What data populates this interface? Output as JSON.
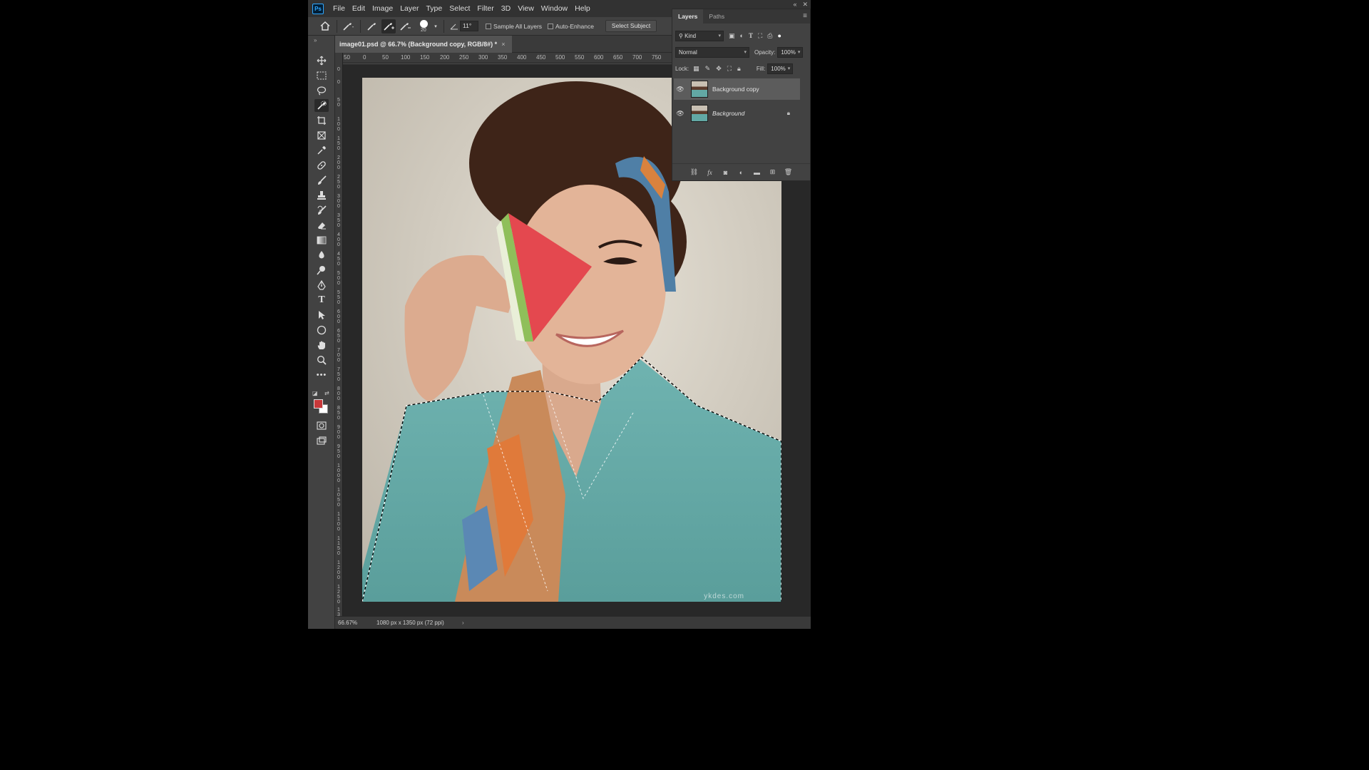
{
  "app": {
    "logo": "Ps"
  },
  "menu": [
    "File",
    "Edit",
    "Image",
    "Layer",
    "Type",
    "Select",
    "Filter",
    "3D",
    "View",
    "Window",
    "Help"
  ],
  "window_controls": {
    "collapse": "«",
    "close": "✕"
  },
  "options": {
    "brush_size": "20",
    "angle": "11°",
    "sample_all_layers": "Sample All Layers",
    "auto_enhance": "Auto-Enhance",
    "select_subject": "Select Subject"
  },
  "document": {
    "tab_title": "image01.psd @ 66.7% (Background copy, RGB/8#) *",
    "close": "×"
  },
  "ruler": {
    "h_ticks": [
      "50",
      "0",
      "50",
      "100",
      "150",
      "200",
      "250",
      "300",
      "350",
      "400",
      "450",
      "500",
      "550",
      "600",
      "650",
      "700",
      "750"
    ],
    "v_ticks": [
      "0",
      "0",
      "5 0",
      "1 0 0",
      "1 5 0",
      "2 0 0",
      "2 5 0",
      "3 0 0",
      "3 5 0",
      "4 0 0",
      "4 5 0",
      "5 0 0",
      "5 5 0",
      "6 0 0",
      "6 5 0",
      "7 0 0",
      "7 5 0",
      "8 0 0",
      "8 5 0",
      "9 0 0",
      "9 5 0",
      "1 0 0 0",
      "1 0 5 0",
      "1 1 0 0",
      "1 1 5 0",
      "1 2 0 0",
      "1 2 5 0",
      "1 3 0 0"
    ]
  },
  "status": {
    "zoom": "66.67%",
    "doc_info": "1080 px x 1350 px (72 ppi)",
    "arrow": "›"
  },
  "layers_panel": {
    "tabs": [
      "Layers",
      "Paths"
    ],
    "filter_kind": "Kind",
    "blend_mode": "Normal",
    "opacity_label": "Opacity:",
    "opacity_value": "100%",
    "lock_label": "Lock:",
    "fill_label": "Fill:",
    "fill_value": "100%",
    "layers": [
      {
        "name": "Background copy",
        "selected": true,
        "locked": false
      },
      {
        "name": "Background",
        "selected": false,
        "locked": true
      }
    ]
  },
  "watermark": "ykdes.com",
  "colors": {
    "foreground": "#c9383a",
    "background": "#ffffff",
    "accent": "#31a8ff"
  }
}
